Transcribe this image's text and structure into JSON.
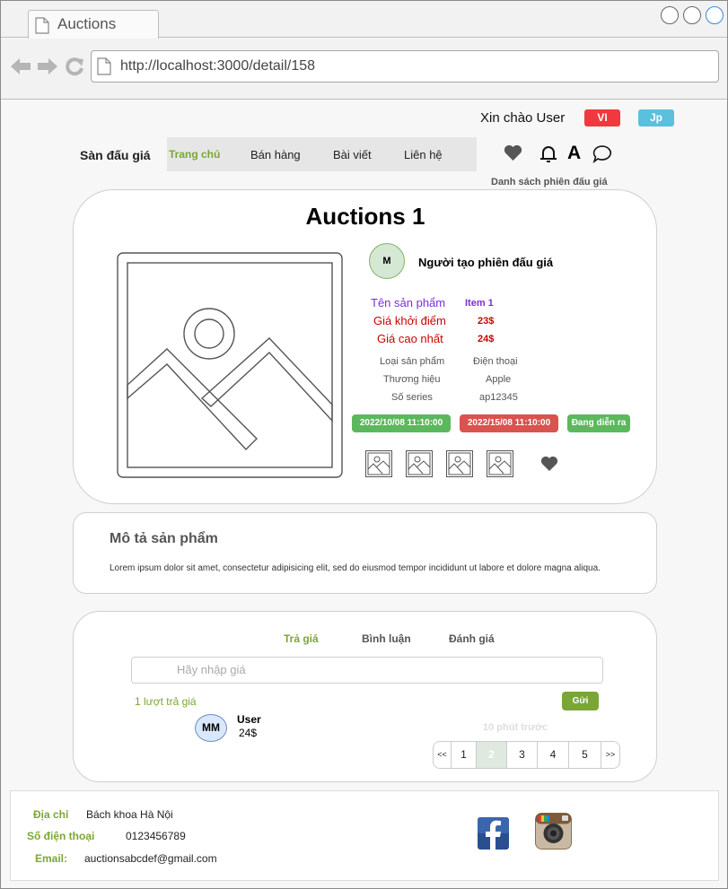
{
  "browser": {
    "tab_title": "Auctions",
    "url": "http://localhost:3000/detail/158"
  },
  "header": {
    "greeting": "Xin chào User",
    "lang_vi": "VI",
    "lang_jp": "Jp",
    "brand": "Sàn đấu giá",
    "nav": [
      "Trang chủ",
      "Bán hàng",
      "Bài viết",
      "Liên hệ"
    ],
    "font_icon_label": "A",
    "auction_list_link": "Danh sách phiên đấu giá"
  },
  "auction": {
    "title": "Auctions 1",
    "creator_avatar": "M",
    "creator_label": "Người tạo phiên đấu giá",
    "product_name_label": "Tên sản phẩm",
    "product_name": "Item 1",
    "start_price_label": "Giá khởi điểm",
    "start_price": "23$",
    "max_price_label": "Giá cao nhất",
    "max_price": "24$",
    "category_label": "Loại sản phẩm",
    "category": "Điện thoại",
    "brand_label": "Thương hiệu",
    "brand": "Apple",
    "serial_label": "Số series",
    "serial": "ap12345",
    "start_time": "2022/10/08 11:10:00",
    "end_time": "2022/15/08 11:10:00",
    "status": "Đang diễn ra"
  },
  "description": {
    "title": "Mô tả sản phẩm",
    "text": "Lorem ipsum dolor sit amet, consectetur adipisicing elit, sed do eiusmod tempor incididunt ut labore et dolore magna aliqua."
  },
  "bidding": {
    "tabs": [
      "Trả giá",
      "Bình luận",
      "Đánh giá"
    ],
    "input_placeholder": "Hãy nhập giá",
    "count_text": "1 lượt trả giá",
    "send_label": "Gửi",
    "bid": {
      "avatar": "MM",
      "user": "User",
      "amount": "24$",
      "time": "10 phút trước"
    },
    "pagination": [
      "<<",
      "1",
      "2",
      "3",
      "4",
      "5",
      ">>"
    ]
  },
  "footer": {
    "address_label": "Địa chỉ",
    "address": "Bách khoa Hà Nội",
    "phone_label": "Số điện thoại",
    "phone": "0123456789",
    "email_label": "Email:",
    "email": "auctionsabcdef@gmail.com"
  },
  "colors": {
    "accent_green": "#7aa635",
    "red": "#d9534f",
    "badge_green": "#5cb85c",
    "purple": "#7b2fd6",
    "jp_blue": "#5bc0de"
  }
}
